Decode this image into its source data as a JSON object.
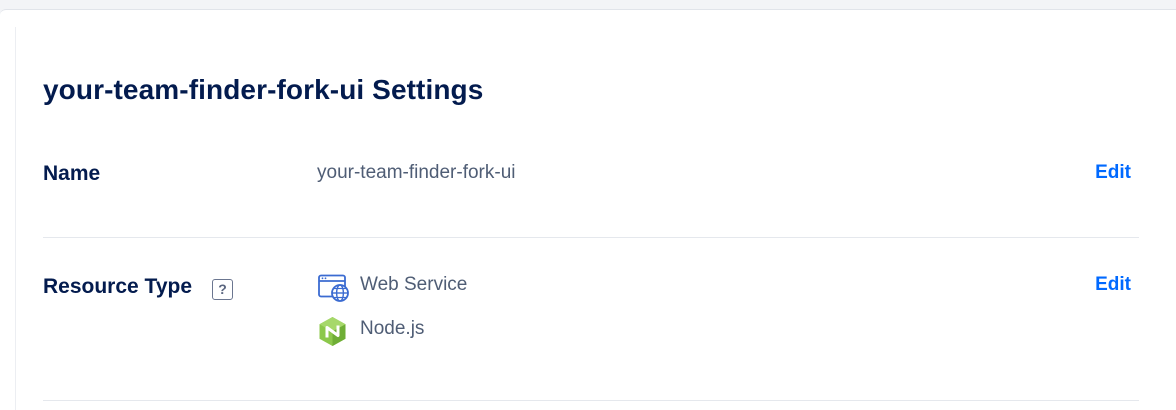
{
  "settings": {
    "title": "your-team-finder-fork-ui Settings"
  },
  "name_row": {
    "label": "Name",
    "value": "your-team-finder-fork-ui",
    "edit_label": "Edit"
  },
  "resource_row": {
    "label": "Resource Type",
    "help_glyph": "?",
    "items": [
      {
        "icon": "web-service-icon",
        "label": "Web Service"
      },
      {
        "icon": "nodejs-icon",
        "label": "Node.js"
      }
    ],
    "edit_label": "Edit"
  },
  "colors": {
    "heading": "#031b4e",
    "value_text": "#4f5d75",
    "link": "#0069ff",
    "nodejs_green": "#8cc84b"
  }
}
